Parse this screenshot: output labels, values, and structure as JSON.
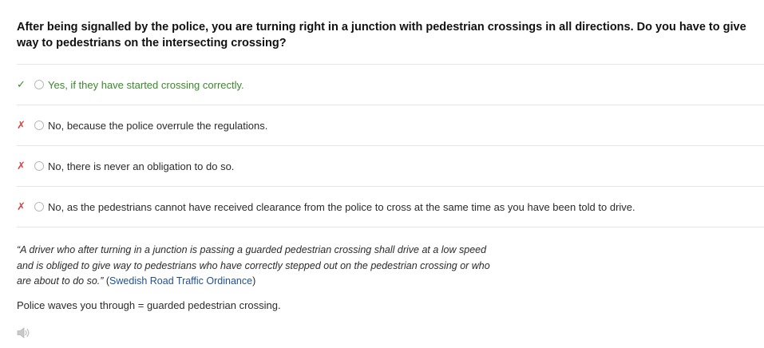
{
  "question": "After being signalled by the police, you are turning right in a junction with pedestrian crossings in all directions. Do you have to give way to pedestrians on the intersecting crossing?",
  "answers": [
    {
      "mark": "✓",
      "label": "Yes, if they have started crossing correctly.",
      "correct": true
    },
    {
      "mark": "✗",
      "label": "No, because the police overrule the regulations.",
      "correct": false
    },
    {
      "mark": "✗",
      "label": "No, there is never an obligation to do so.",
      "correct": false
    },
    {
      "mark": "✗",
      "label": "No, as the pedestrians cannot have received clearance from the police to cross at the same time as you have been told to drive.",
      "correct": false
    }
  ],
  "explanation": {
    "quote": "“A driver who after turning in a junction is passing a guarded pedestrian crossing shall drive at a low speed and is obliged to give way to pedestrians who have correctly stepped out on the pedestrian crossing or who are about to do so.”",
    "source_open": " (",
    "source_link": "Swedish Road Traffic Ordinance",
    "source_close": ")"
  },
  "note": "Police waves you through = guarded pedestrian crossing.",
  "audio_icon": "speaker-icon",
  "colors": {
    "correct": "#3a8a2a",
    "wrong": "#d64541",
    "link": "#1f4f9c"
  }
}
